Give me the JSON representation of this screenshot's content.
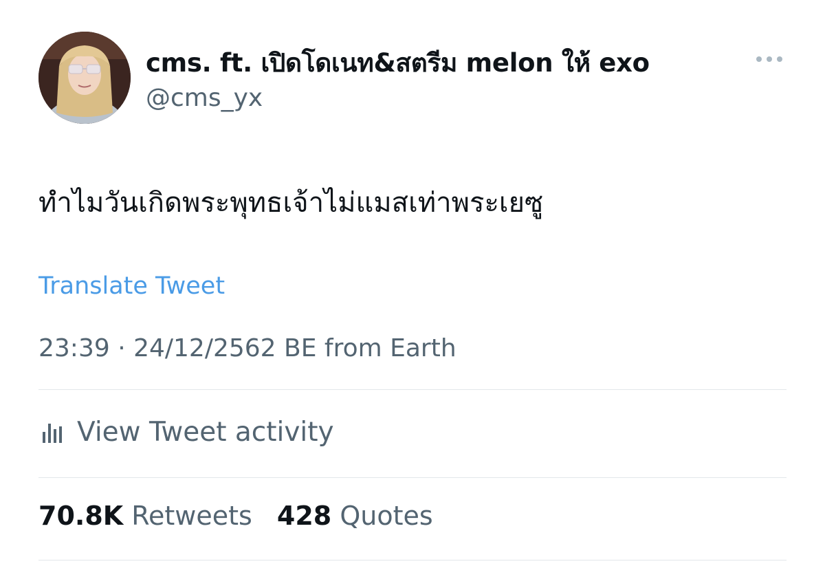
{
  "author": {
    "display_name": "cms. ft. เปิดโดเนท&สตรีม melon ให้ exo",
    "handle": "@cms_yx",
    "avatar_icon": "profile-photo"
  },
  "more_icon": "ellipsis-icon",
  "tweet": {
    "text": "ทำไมวันเกิดพระพุทธเจ้าไม่แมสเท่าพระเยซู",
    "translate_label": "Translate Tweet",
    "meta": "23:39 · 24/12/2562 BE from Earth"
  },
  "activity": {
    "icon": "bar-chart-icon",
    "label": "View Tweet activity"
  },
  "stats": {
    "retweets_count": "70.8K",
    "retweets_label": "Retweets",
    "quotes_count": "428",
    "quotes_label": "Quotes"
  },
  "colors": {
    "link": "#4a9be6",
    "text": "#0f1419",
    "secondary": "#536471",
    "divider": "#e3e7ea"
  }
}
